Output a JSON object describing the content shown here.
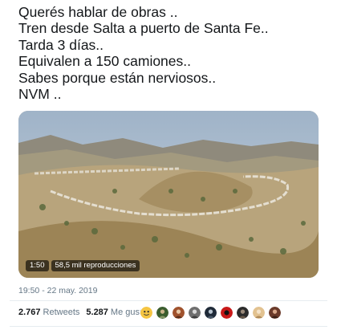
{
  "tweet": {
    "lines": [
      "Querés hablar de obras ..",
      "Tren desde Salta a puerto de Santa Fe..",
      "Tarda 3 días..",
      "Equivalen a 150 camiones..",
      "Sabes porque están nerviosos..",
      "NVM .."
    ]
  },
  "media": {
    "duration": "1:50",
    "views": "58,5 mil reproducciones"
  },
  "timestamp": "19:50 - 22 may. 2019",
  "stats": {
    "retweets_count": "2.767",
    "retweets_label": "Retweets",
    "likes_count": "5.287",
    "likes_label": "Me gusta"
  },
  "avatars": [
    {
      "icon": "emoji-avatar",
      "color": "#f5c542"
    },
    {
      "icon": "emoji-avatar",
      "color": "#3a5d2e"
    },
    {
      "icon": "user-avatar",
      "color": "#a0522d"
    },
    {
      "icon": "user-avatar",
      "color": "#6f6f6f"
    },
    {
      "icon": "user-avatar",
      "color": "#1f2a38"
    },
    {
      "icon": "user-avatar",
      "color": "#c81818"
    },
    {
      "icon": "user-avatar",
      "color": "#2b2b2b"
    },
    {
      "icon": "user-avatar",
      "color": "#e2c290"
    },
    {
      "icon": "user-avatar",
      "color": "#6b3a2a"
    }
  ]
}
